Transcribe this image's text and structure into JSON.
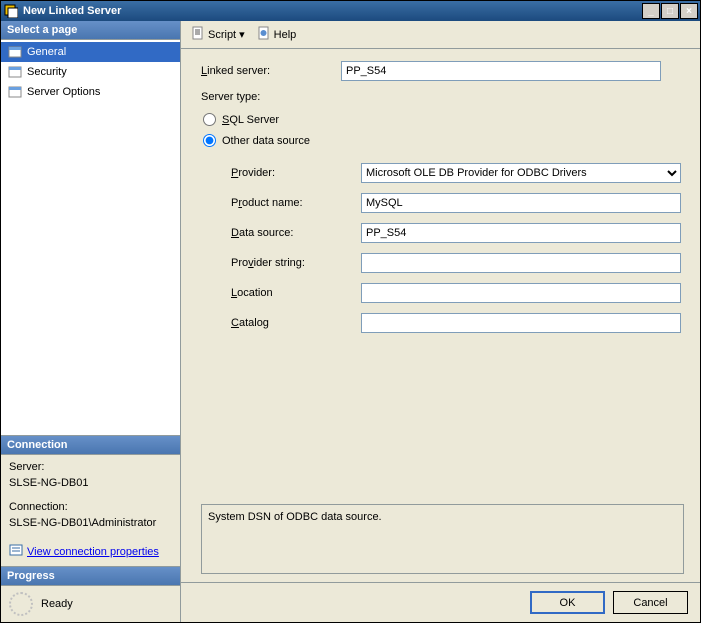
{
  "title": "New Linked Server",
  "sidebar": {
    "select_page_label": "Select a page",
    "pages": [
      "General",
      "Security",
      "Server Options"
    ],
    "connection_label": "Connection",
    "server_label": "Server:",
    "server_value": "SLSE-NG-DB01",
    "conn_label": "Connection:",
    "conn_value": "SLSE-NG-DB01\\Administrator",
    "view_conn_link": "View connection properties",
    "progress_label": "Progress",
    "progress_status": "Ready"
  },
  "toolbar": {
    "script_label": "Script",
    "help_label": "Help"
  },
  "form": {
    "linked_server_label": "Linked server:",
    "linked_server_value": "PP_S54",
    "server_type_label": "Server type:",
    "radio_sql": "SQL Server",
    "radio_other": "Other data source",
    "provider_label": "Provider:",
    "provider_value": "Microsoft OLE DB Provider for ODBC Drivers",
    "product_name_label": "Product name:",
    "product_name_value": "MySQL",
    "data_source_label": "Data source:",
    "data_source_value": "PP_S54",
    "provider_string_label": "Provider string:",
    "provider_string_value": "",
    "location_label": "Location",
    "location_value": "",
    "catalog_label": "Catalog",
    "catalog_value": ""
  },
  "status_text": "System DSN of ODBC data source.",
  "buttons": {
    "ok": "OK",
    "cancel": "Cancel"
  }
}
